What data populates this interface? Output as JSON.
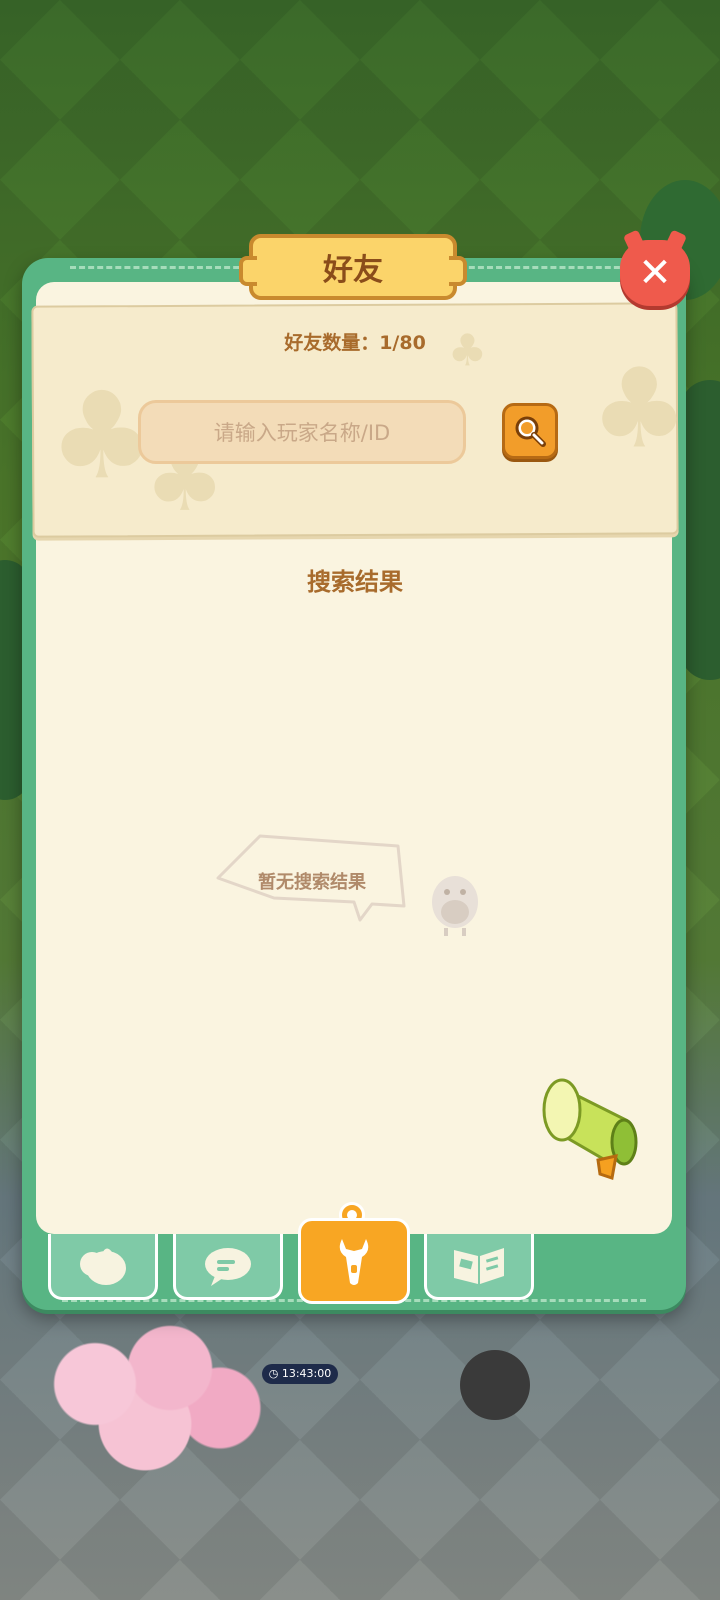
{
  "dialog": {
    "title": "好友",
    "friend_count": "好友数量：1/80",
    "search": {
      "placeholder": "请输入玩家名称/ID"
    },
    "results_title": "搜索结果",
    "empty_text": "暂无搜索结果"
  },
  "tabs": [
    {
      "icon": "chick-icon",
      "active": false
    },
    {
      "icon": "chat-bubble-icon",
      "active": false
    },
    {
      "icon": "wrench-icon",
      "active": true
    },
    {
      "icon": "open-book-icon",
      "active": false
    }
  ],
  "background": {
    "timer": "13:43:00"
  },
  "colors": {
    "dialog_green": "#58b584",
    "panel_cream": "#faf4e0",
    "title_yellow": "#fbd46a",
    "close_red": "#ef5a4c",
    "accent_orange": "#f8a623",
    "text_brown": "#a86b2c"
  }
}
